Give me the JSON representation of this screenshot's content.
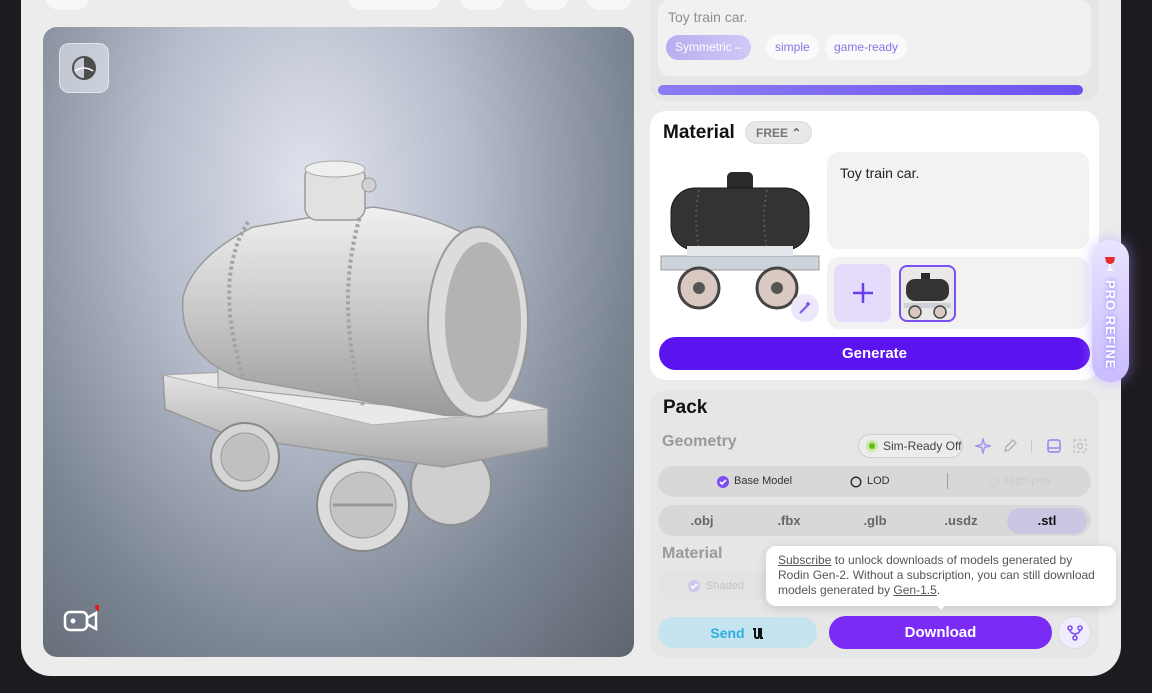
{
  "prompt": {
    "text": "Toy train car.",
    "tags": [
      {
        "label": "Symmetric",
        "active": true
      },
      {
        "label": "simple",
        "active": false
      },
      {
        "label": "game-ready",
        "active": false
      }
    ]
  },
  "material": {
    "title": "Material",
    "badge": "FREE",
    "prompt_text": "Toy train car.",
    "generate_label": "Generate"
  },
  "pro_refine": {
    "label": "PRO REFINE"
  },
  "pack": {
    "title": "Pack",
    "geometry_label": "Geometry",
    "sim_ready_label": "Sim-Ready Off",
    "options": {
      "base_model": "Base Model",
      "lod": "LOD",
      "high_poly": "High-poly"
    },
    "formats": [
      ".obj",
      ".fbx",
      ".glb",
      ".usdz",
      ".stl"
    ],
    "selected_format": ".stl",
    "material_label": "Material",
    "shaded_label": "Shaded",
    "tooltip": {
      "subscribe": "Subscribe",
      "text1": " to unlock downloads of models generated by Rodin Gen-2. Without a subscription, you can still download models generated by ",
      "gen_link": "Gen-1.5",
      "text2": "."
    },
    "send_label": "Send",
    "download_label": "Download"
  },
  "icons": {
    "view_toggle": "contrast-sphere-icon",
    "record": "video-record-icon",
    "wand": "magic-wand-icon",
    "add": "plus-icon",
    "sparkle": "sparkle-icon",
    "pen": "pen-icon",
    "branch": "fork-icon"
  },
  "colors": {
    "accent": "#5b13f0",
    "download": "#7a2cf6",
    "send_bg": "#c5e4ef",
    "send_text": "#2bb0de",
    "sim_dot": "#66b81b",
    "record_dot": "#e61919"
  }
}
